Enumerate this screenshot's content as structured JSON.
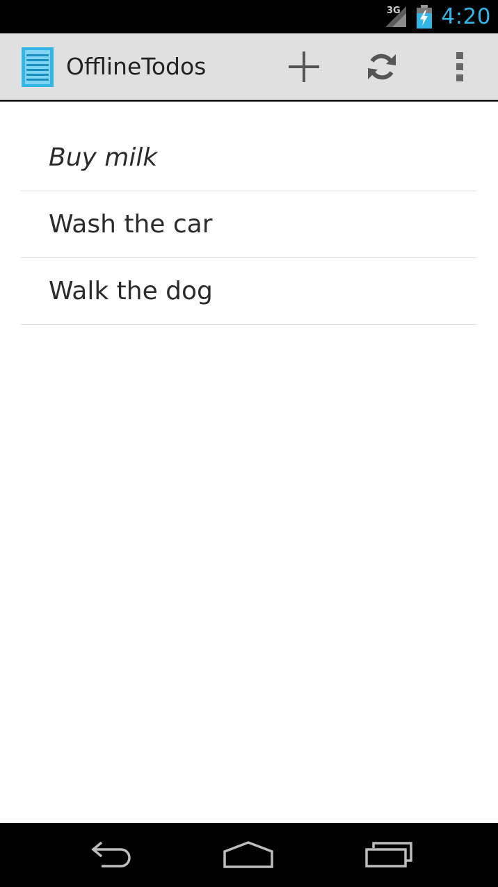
{
  "status_bar": {
    "network": "3G",
    "time": "4:20",
    "icons": [
      "signal-icon",
      "battery-charging-icon"
    ]
  },
  "action_bar": {
    "title": "OfflineTodos",
    "actions": [
      "add-icon",
      "refresh-icon",
      "overflow-menu-icon"
    ]
  },
  "todos": [
    {
      "label": "Buy milk"
    },
    {
      "label": "Wash the car"
    },
    {
      "label": "Walk the dog"
    }
  ],
  "nav_bar": {
    "buttons": [
      "back-icon",
      "home-icon",
      "recents-icon"
    ]
  },
  "colors": {
    "accent": "#33b5e5",
    "action_bar_bg": "#e0e0e0",
    "content_bg": "#ffffff"
  }
}
